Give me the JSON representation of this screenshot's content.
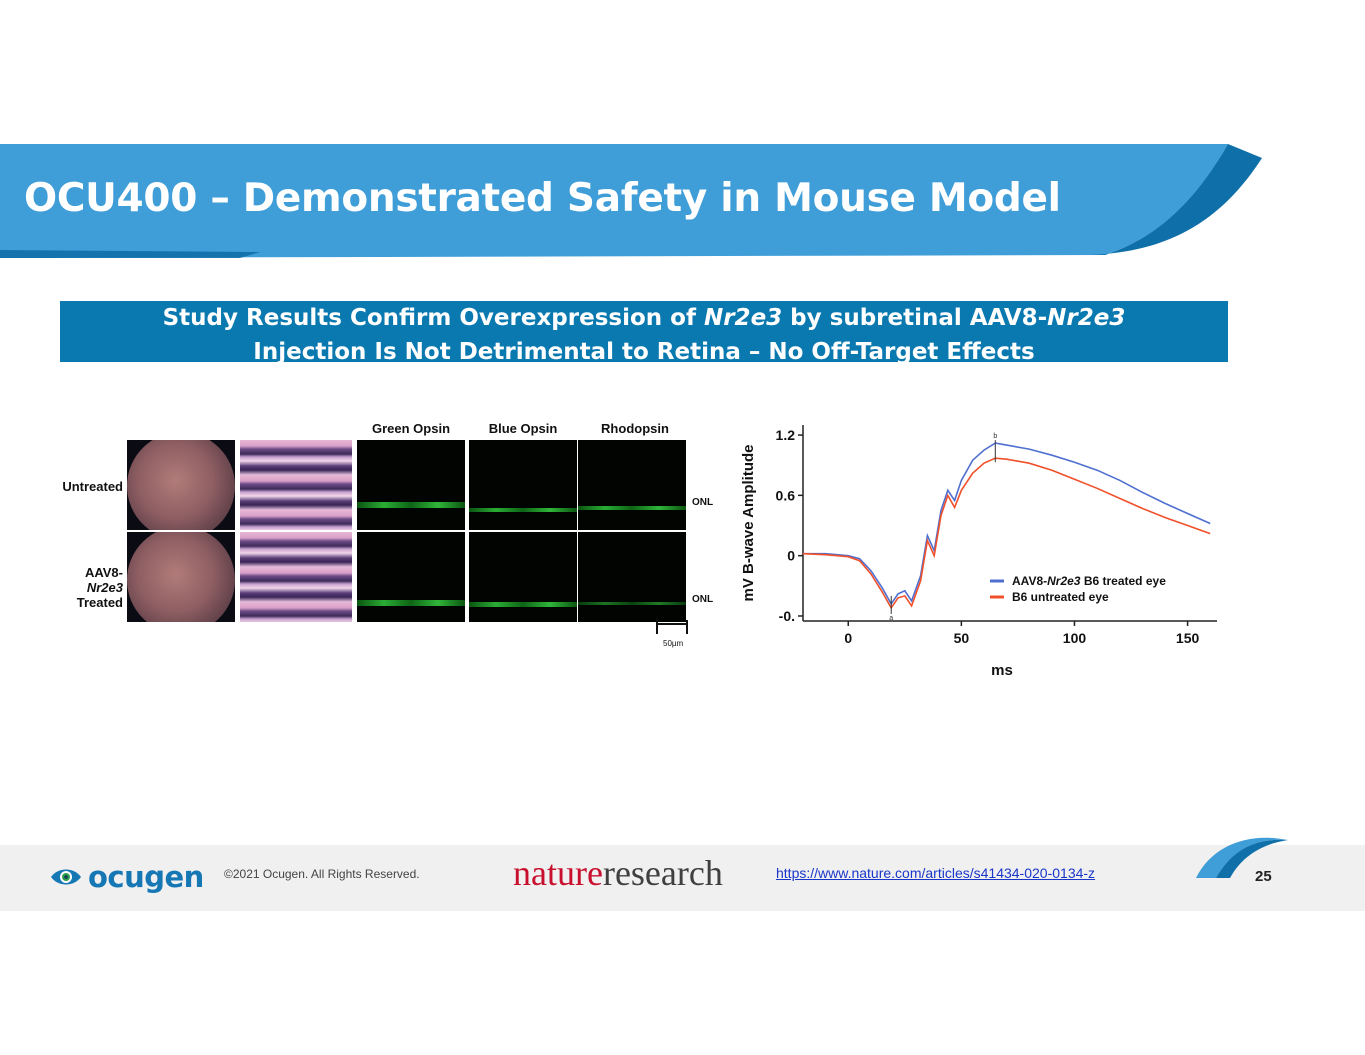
{
  "slide": {
    "title": "OCU400 – Demonstrated Safety in Mouse Model",
    "subtitle": {
      "line1_a": "Study Results Confirm Overexpression of ",
      "line1_b": "Nr2e3",
      "line1_c": " by subretinal AAV8-",
      "line1_d": "Nr2e3",
      "line2": "Injection Is Not Detrimental to Retina – No Off-Target Effects"
    },
    "colors": {
      "banner": "#3f9dd8",
      "banner_dark": "#0f6fa8",
      "subtitle_bg": "#0a79b0"
    }
  },
  "figure": {
    "columns": [
      "Green Opsin",
      "Blue Opsin",
      "Rhodopsin"
    ],
    "rows": {
      "untreated": "Untreated",
      "treated_a": "AAV8-",
      "treated_b": "Nr2e3",
      "treated_c": "Treated"
    },
    "onl_label": "ONL",
    "scale_bar": "50µm"
  },
  "chart_data": {
    "type": "line",
    "xlabel": "ms",
    "ylabel": "mV B-wave  Amplitude",
    "x_ticks": [
      "0",
      "50",
      "100",
      "150"
    ],
    "y_ticks": [
      "1.2",
      "0.6",
      "0",
      "-0."
    ],
    "xlim": [
      -20,
      163
    ],
    "ylim": [
      -0.65,
      1.3
    ],
    "series": [
      {
        "name_a": "AAV8-",
        "name_b": "Nr2e3",
        "name_c": " B6 treated eye",
        "color": "#4f6fd0",
        "points": [
          [
            -20,
            0.02
          ],
          [
            -10,
            0.02
          ],
          [
            0,
            0.0
          ],
          [
            5,
            -0.03
          ],
          [
            10,
            -0.15
          ],
          [
            15,
            -0.32
          ],
          [
            19,
            -0.48
          ],
          [
            22,
            -0.38
          ],
          [
            25,
            -0.35
          ],
          [
            28,
            -0.45
          ],
          [
            32,
            -0.2
          ],
          [
            35,
            0.2
          ],
          [
            38,
            0.05
          ],
          [
            41,
            0.45
          ],
          [
            44,
            0.65
          ],
          [
            47,
            0.55
          ],
          [
            50,
            0.75
          ],
          [
            55,
            0.95
          ],
          [
            60,
            1.05
          ],
          [
            65,
            1.12
          ],
          [
            70,
            1.1
          ],
          [
            80,
            1.06
          ],
          [
            90,
            1.0
          ],
          [
            100,
            0.93
          ],
          [
            110,
            0.85
          ],
          [
            120,
            0.75
          ],
          [
            130,
            0.63
          ],
          [
            140,
            0.52
          ],
          [
            150,
            0.42
          ],
          [
            160,
            0.32
          ]
        ]
      },
      {
        "name": "B6 untreated eye",
        "color": "#f0502a",
        "points": [
          [
            -20,
            0.02
          ],
          [
            -10,
            0.01
          ],
          [
            0,
            -0.01
          ],
          [
            5,
            -0.05
          ],
          [
            10,
            -0.18
          ],
          [
            15,
            -0.36
          ],
          [
            19,
            -0.52
          ],
          [
            22,
            -0.42
          ],
          [
            25,
            -0.4
          ],
          [
            28,
            -0.5
          ],
          [
            32,
            -0.25
          ],
          [
            35,
            0.15
          ],
          [
            38,
            0.0
          ],
          [
            41,
            0.4
          ],
          [
            44,
            0.6
          ],
          [
            47,
            0.48
          ],
          [
            50,
            0.65
          ],
          [
            55,
            0.82
          ],
          [
            60,
            0.92
          ],
          [
            65,
            0.97
          ],
          [
            70,
            0.96
          ],
          [
            80,
            0.92
          ],
          [
            90,
            0.85
          ],
          [
            100,
            0.76
          ],
          [
            110,
            0.67
          ],
          [
            120,
            0.57
          ],
          [
            130,
            0.47
          ],
          [
            140,
            0.38
          ],
          [
            150,
            0.3
          ],
          [
            160,
            0.22
          ]
        ]
      }
    ],
    "annotations": {
      "a": "a",
      "b": "b"
    },
    "legend_position": "bottom-right",
    "grid": false
  },
  "footer": {
    "logo_text": "ocugen",
    "copyright": "©2021  Ocugen. All Rights Reserved.",
    "nature_a": "nature",
    "nature_b": "research",
    "link": "https://www.nature.com/articles/s41434-020-0134-z",
    "page_number": "25"
  }
}
